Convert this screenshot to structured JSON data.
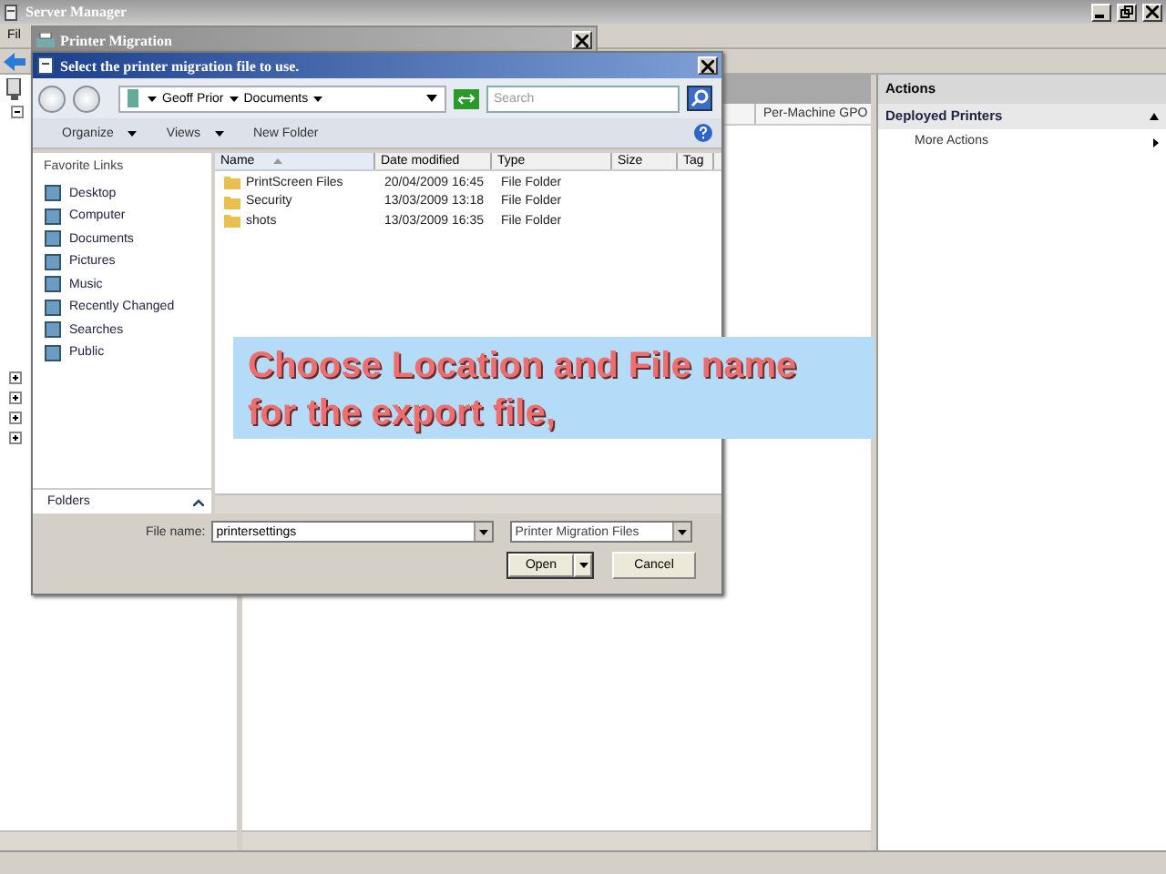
{
  "window": {
    "title": "Server Manager"
  },
  "menu_bar": {
    "items": [
      "Fil"
    ]
  },
  "tree": {
    "nodes": [
      {
        "expanded": false
      },
      {
        "expanded": false
      },
      {
        "expanded": false
      },
      {
        "expanded": false
      }
    ]
  },
  "table": {
    "columns": [
      "Per-Machine GPO"
    ]
  },
  "actions_pane": {
    "title": "Actions",
    "section": {
      "title": "Deployed Printers",
      "expanded": true
    },
    "items": [
      "More Actions"
    ]
  },
  "migration_wizard": {
    "title": "Printer Migration"
  },
  "file_dialog": {
    "title": "Select the printer migration file to use.",
    "breadcrumb": [
      "Geoff Prior",
      "Documents"
    ],
    "search": {
      "placeholder": "Search"
    },
    "toolbar": [
      {
        "label": "Organize",
        "has_menu": true
      },
      {
        "label": "Views",
        "has_menu": true
      },
      {
        "label": "New Folder",
        "has_menu": false
      }
    ],
    "favorite_links": {
      "title": "Favorite Links",
      "items": [
        "Desktop",
        "Computer",
        "Documents",
        "Pictures",
        "Music",
        "Recently Changed",
        "Searches",
        "Public"
      ]
    },
    "folders_bar": {
      "label": "Folders"
    },
    "columns": [
      {
        "label": "Name",
        "sorted": true
      },
      {
        "label": "Date modified",
        "sorted": false
      },
      {
        "label": "Type",
        "sorted": false
      },
      {
        "label": "Size",
        "sorted": false
      },
      {
        "label": "Tag",
        "sorted": false
      }
    ],
    "rows": [
      {
        "name": "PrintScreen Files",
        "date_modified": "20/04/2009 16:45",
        "type": "File Folder"
      },
      {
        "name": "Security",
        "date_modified": "13/03/2009 13:18",
        "type": "File Folder"
      },
      {
        "name": "shots",
        "date_modified": "13/03/2009 16:35",
        "type": "File Folder"
      }
    ],
    "file_name": {
      "label": "File name:",
      "value": "printersettings"
    },
    "file_type": {
      "value": "Printer Migration Files"
    },
    "buttons": [
      {
        "label": "Open",
        "kind": "split"
      },
      {
        "label": "Cancel",
        "kind": "plain"
      }
    ]
  },
  "callout": {
    "text": "Choose Location and File name for the export file,"
  }
}
